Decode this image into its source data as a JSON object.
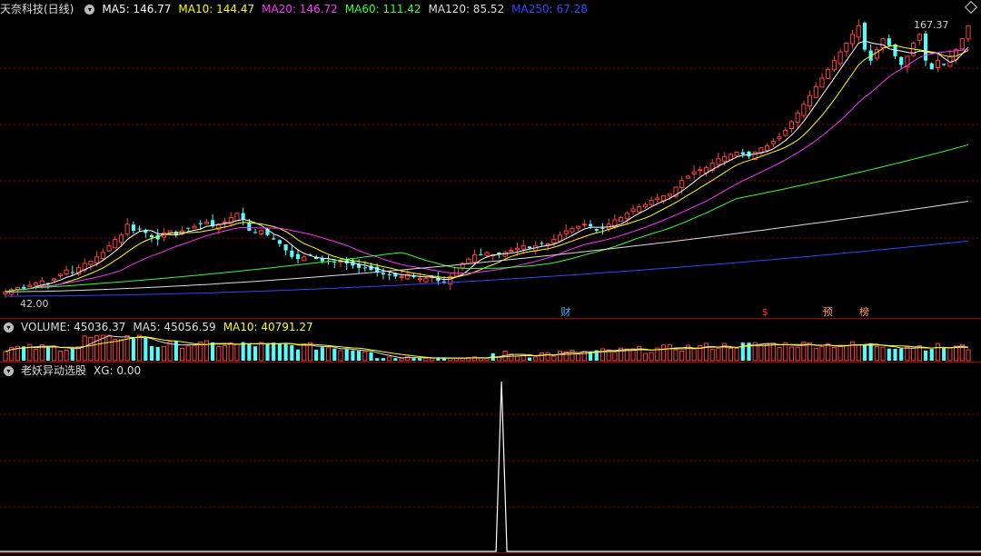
{
  "main_header": {
    "title": "天奈科技(日线)",
    "items": [
      {
        "label": "MA5: 146.77",
        "color": "#ffffff"
      },
      {
        "label": "MA10: 144.47",
        "color": "#ffff00"
      },
      {
        "label": "MA20: 146.72",
        "color": "#ff33ff"
      },
      {
        "label": "MA60: 111.42",
        "color": "#33ff33"
      },
      {
        "label": "MA120: 85.52",
        "color": "#dddddd"
      },
      {
        "label": "MA250: 67.28",
        "color": "#3344ff"
      }
    ]
  },
  "volume_header": {
    "items": [
      {
        "label": "VOLUME: 45036.37",
        "color": "#dddddd"
      },
      {
        "label": "MA5: 45056.59",
        "color": "#dddddd"
      },
      {
        "label": "MA10: 40791.27",
        "color": "#ffff00"
      }
    ]
  },
  "indicator_header": {
    "items": [
      {
        "label": "老妖异动选股",
        "color": "#dddddd"
      },
      {
        "label": "XG: 0.00",
        "color": "#dddddd"
      }
    ]
  },
  "price_labels": {
    "high": "167.37",
    "low": "42.00"
  },
  "event_markers": [
    {
      "label": "财",
      "color": "#55aaff",
      "day": 92
    },
    {
      "label": "$",
      "color": "#ff3333",
      "day": 125
    },
    {
      "label": "预",
      "color": "#ff9955",
      "day": 135
    },
    {
      "label": "榜",
      "color": "#ff9955",
      "day": 141
    }
  ],
  "colors": {
    "up": "#ff4040",
    "down": "#54fcfc",
    "grid": "#a00000",
    "indicator_line": "#ffffff"
  },
  "chart_data": {
    "type": "candlestick",
    "days": 159,
    "ylim": [
      42.0,
      167.37
    ],
    "closes": [
      44,
      45,
      46,
      45.5,
      47,
      48,
      49,
      48,
      50,
      52,
      54,
      53,
      55,
      57,
      58,
      60,
      62,
      65,
      68,
      70,
      75,
      72,
      73,
      71,
      69,
      68,
      71,
      72,
      70,
      72,
      73,
      74,
      75,
      76,
      74,
      75,
      76,
      78,
      80,
      77,
      72,
      71,
      72,
      70,
      68,
      66,
      63,
      60,
      59,
      60,
      61,
      59,
      58,
      58,
      57.5,
      58,
      57,
      56,
      55,
      55,
      54,
      53,
      52,
      52,
      51,
      51,
      52,
      51,
      50,
      50,
      51,
      49,
      48,
      51,
      55,
      57,
      59,
      61,
      61,
      62,
      61,
      61,
      62,
      63,
      64,
      65,
      64,
      65,
      66,
      66,
      68,
      70,
      72,
      73,
      74,
      75,
      74,
      72,
      73,
      75,
      77,
      78,
      80,
      82,
      83,
      84,
      86,
      87,
      88,
      89,
      92,
      95,
      97,
      99,
      100,
      101,
      103,
      105,
      106,
      107,
      108,
      107,
      106,
      108,
      110,
      111,
      113,
      115,
      118,
      122,
      126,
      130,
      134,
      138,
      142,
      146,
      150,
      154,
      158,
      162,
      166,
      155,
      150,
      155,
      160,
      157,
      152,
      148,
      152,
      158,
      162,
      150,
      146,
      150,
      148,
      152,
      155,
      160,
      166
    ],
    "ma60_end": 111.42,
    "ma120_end": 85.52,
    "ma250_end": 67.28,
    "volume": {
      "last": 45036.37,
      "ma5": 45056.59,
      "ma10": 40791.27
    },
    "indicator": {
      "name": "老妖异动选股",
      "series_name": "XG",
      "last": 0.0,
      "spike_day": 82,
      "spike_value": 1.0
    }
  }
}
